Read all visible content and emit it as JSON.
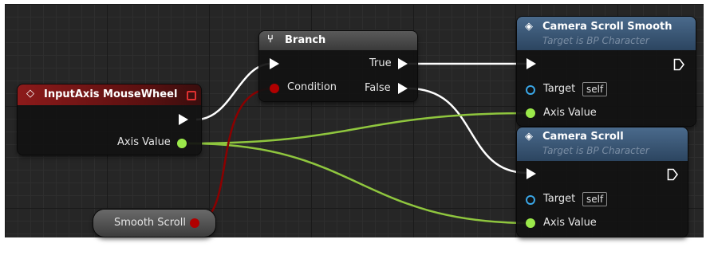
{
  "colors": {
    "exec_wire": "#ffffff",
    "float_wire": "#9acd32",
    "bool_wire": "#8b0000",
    "event_header": "#8a1a1a",
    "flow_header": "#4a4a4a",
    "function_header": "#3d5a78",
    "float_pin": "#9be94a",
    "bool_pin": "#b00000",
    "target_pin": "#3aa7e8"
  },
  "nodes": {
    "input_axis": {
      "title": "InputAxis MouseWheel",
      "icon": "diamond-event-icon",
      "axis_value_label": "Axis Value"
    },
    "branch": {
      "title": "Branch",
      "icon": "branch-icon",
      "condition_label": "Condition",
      "true_label": "True",
      "false_label": "False"
    },
    "camera_scroll_smooth": {
      "title": "Camera Scroll Smooth",
      "subtitle": "Target is BP Character",
      "icon": "function-icon",
      "target_label": "Target",
      "target_value": "self",
      "axis_value_label": "Axis Value"
    },
    "camera_scroll": {
      "title": "Camera Scroll",
      "subtitle": "Target is BP Character",
      "icon": "function-icon",
      "target_label": "Target",
      "target_value": "self",
      "axis_value_label": "Axis Value"
    },
    "smooth_scroll_var": {
      "label": "Smooth Scroll"
    }
  }
}
